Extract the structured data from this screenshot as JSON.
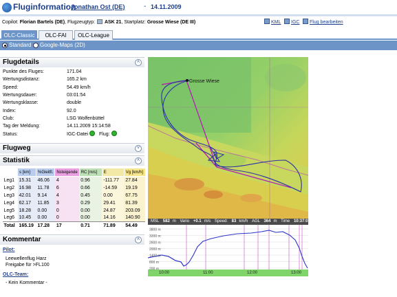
{
  "header": {
    "title": "Fluginformation",
    "pilot": "Jonathan Ost (DE)",
    "separator": "-",
    "date": "14.11.2009"
  },
  "info": {
    "copilot_label": "Copilot:",
    "copilot": "Florian Bartels (DE)",
    "aircraft_label": "Flugzeugtyp:",
    "aircraft": "ASK 21",
    "takeoff_label": "Startplatz:",
    "takeoff": "Grosse Wiese (DE III)"
  },
  "toplinks": [
    "KML",
    "IGC",
    "Flug bearbeiten"
  ],
  "tabs": [
    "OLC-Classic",
    "OLC-FAI",
    "OLC-League"
  ],
  "view": {
    "options": [
      "Standard",
      "Google-Maps (2D)"
    ],
    "selected": "Standard"
  },
  "flight_details": {
    "heading": "Flugdetails",
    "rows": [
      {
        "label": "Punkte des Fluges:",
        "value": "171.04"
      },
      {
        "label": "Wertungsdistanz:",
        "value": "165.2 km"
      },
      {
        "label": "Speed:",
        "value": "54.49 km/h"
      },
      {
        "label": "Wertungsdauer:",
        "value": "03:01:54"
      },
      {
        "label": "Wertungsklasse:",
        "value": "double"
      },
      {
        "label": "Index:",
        "value": "92.0"
      },
      {
        "label": "Club:",
        "value": "LSG Wolfenbüttel"
      },
      {
        "label": "Tag der Meldung:",
        "value": "14.11.2009 15:14:58"
      }
    ],
    "status_label": "Status:",
    "status_igc": "IGC-Datei",
    "status_flug": "Flug:"
  },
  "flugweg": {
    "heading": "Flugweg"
  },
  "statistik": {
    "heading": "Statistik",
    "columns": [
      "s [km]",
      "%Gleitfl.",
      "Nsteigende",
      "RC [m/s]",
      "E",
      "Vg [km/h]"
    ],
    "rows": [
      [
        "Leg1",
        "15.31",
        "46.06",
        "4",
        "0.96",
        "-111.77",
        "27.84"
      ],
      [
        "Leg2",
        "16.98",
        "11.78",
        "6",
        "0.66",
        "-14.59",
        "19.19"
      ],
      [
        "Leg3",
        "42.01",
        "9.14",
        "4",
        "0.45",
        "0.00",
        "67.75"
      ],
      [
        "Leg4",
        "62.17",
        "11.85",
        "3",
        "0.29",
        "29.41",
        "81.39"
      ],
      [
        "Leg5",
        "18.28",
        "0.00",
        "0",
        "0.00",
        "24.87",
        "203.09"
      ],
      [
        "Leg6",
        "10.45",
        "0.00",
        "0",
        "0.00",
        "14.16",
        "140.90"
      ],
      [
        "Total",
        "165.19",
        "17.28",
        "17",
        "0.71",
        "71.89",
        "54.49"
      ]
    ]
  },
  "kommentar": {
    "heading": "Kommentar",
    "pilot_label": "Pilot:",
    "pilot_lines": [
      "Leewellenflug Harz",
      "Freigabe für >FL100"
    ],
    "olc_label": "OLC-Team:",
    "olc_text": "- Kein Kommentar -"
  },
  "map": {
    "place_label": "Grosse Wiese",
    "readout": {
      "msl_label": "MSL",
      "msl": "582",
      "msl_unit": "m",
      "vario_label": "Vario",
      "vario": "+0.1",
      "vario_unit": "m/s",
      "speed_label": "Speed:",
      "speed": "83",
      "speed_unit": "km/h",
      "agl_label": "AGL",
      "agl": "364",
      "agl_unit": "m",
      "time_label": "Time",
      "time": "10:37:01"
    },
    "baro_times": [
      "10:00",
      "11:00",
      "12:00",
      "13:00"
    ],
    "baro_altitudes": [
      "3800 m",
      "3200 m",
      "2600 m",
      "2000 m",
      "1400 m",
      "800 m",
      "200 m"
    ]
  },
  "colors": {
    "accent": "#6c94c6",
    "title": "#1d3f8a",
    "track": "#2b2fa8",
    "olc_task": "#c040c0",
    "status_ok": "#2fb52f"
  }
}
